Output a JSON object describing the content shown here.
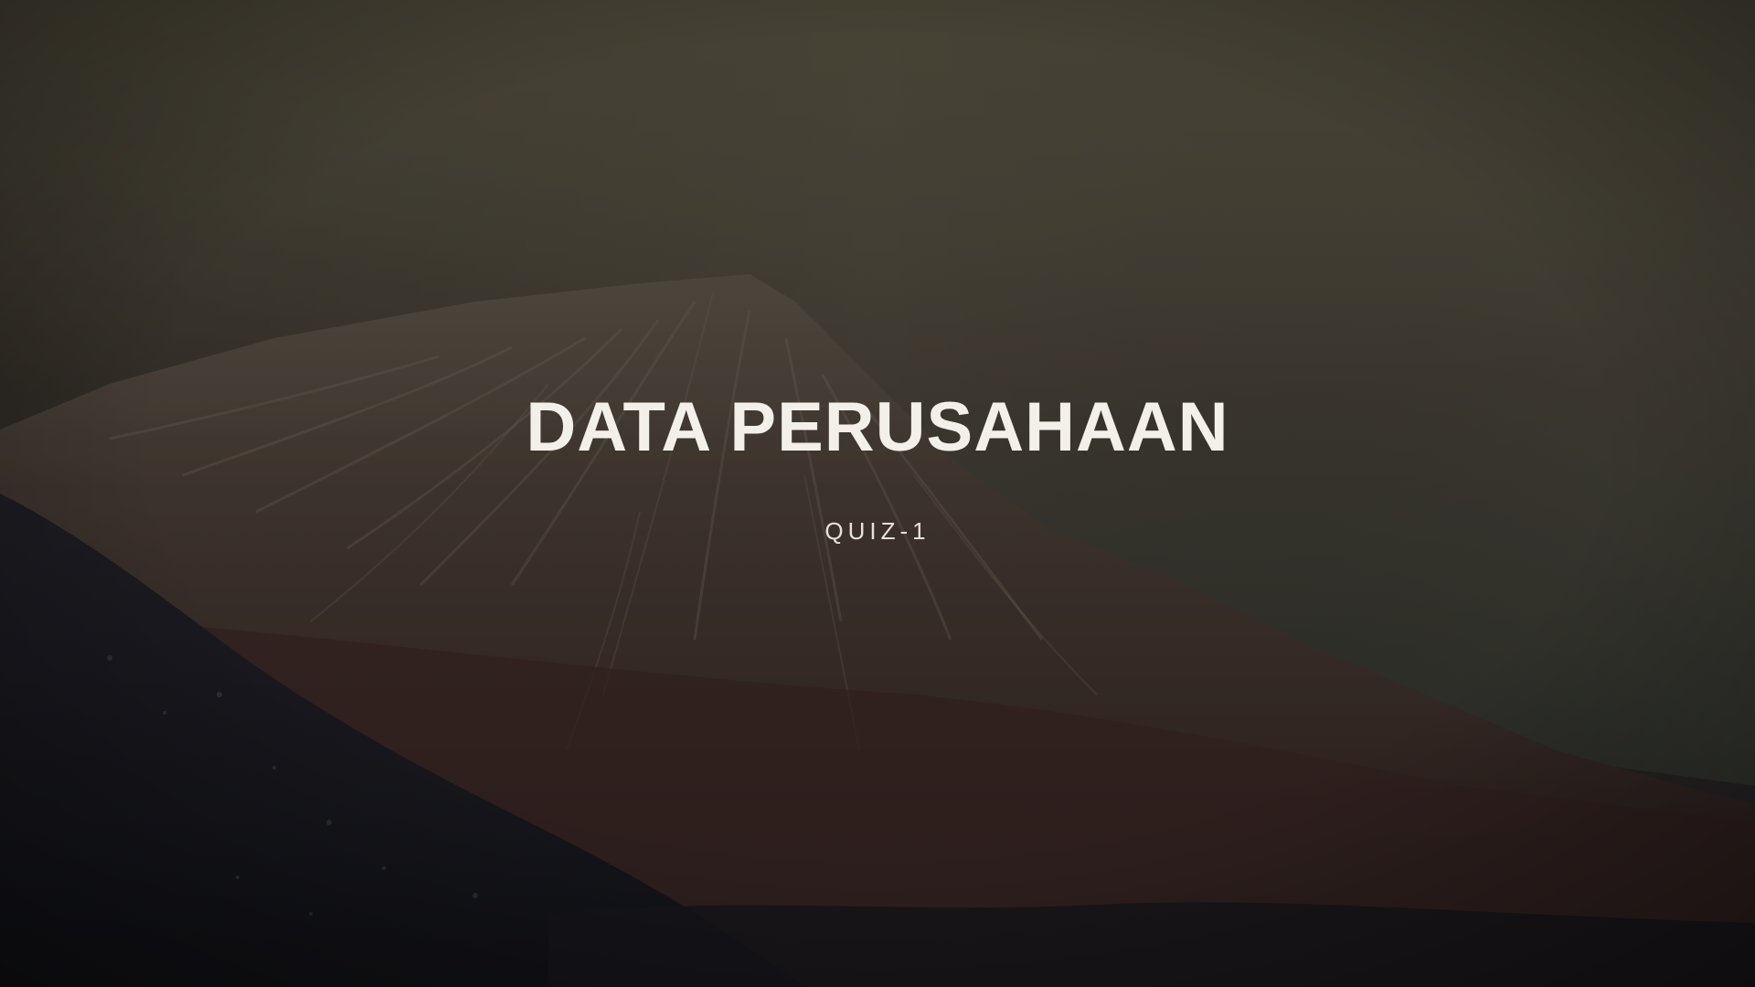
{
  "slide": {
    "title": "DATA PERUSAHAAN",
    "subtitle": "QUIZ-1"
  },
  "background": {
    "description_icon": "foggy-mountain-photo",
    "colors": {
      "sky_top": "#5a5749",
      "sky_mid": "#4b443b",
      "sky_right": "#3c3f38",
      "mountain": "#3a302b",
      "mountain_ridge": "#6e6357",
      "foreground": "#1a1a22",
      "title_text": "#f3f0ea"
    }
  }
}
